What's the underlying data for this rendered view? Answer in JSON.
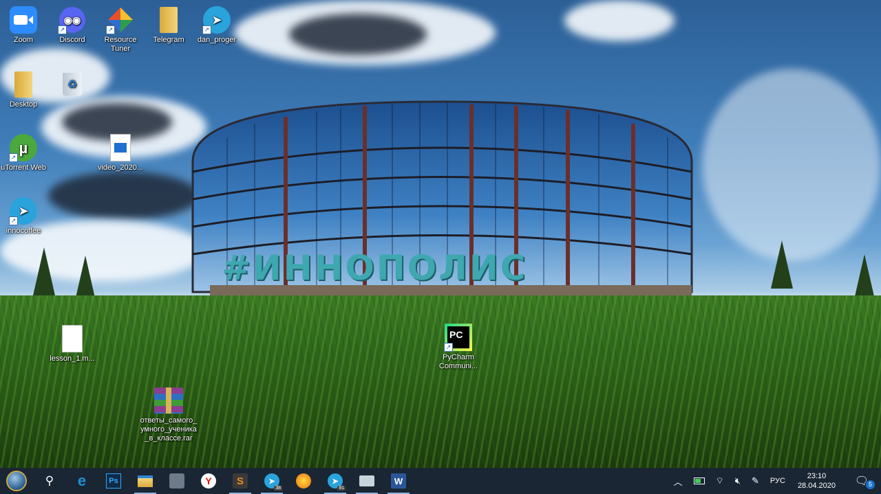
{
  "desktop": {
    "wallpaper_sign": "#ИННОПОЛИС",
    "icons": [
      {
        "label": "Zoom",
        "icon": "zoom-icon",
        "color": "#2d8cff"
      },
      {
        "label": "Discord",
        "icon": "discord-icon",
        "color": "#5865f2"
      },
      {
        "label": "Resource Tuner",
        "icon": "resource-tuner-icon",
        "color": "#e94e2c"
      },
      {
        "label": "Telegram",
        "icon": "folder-icon",
        "color": "#e8c15a"
      },
      {
        "label": "dan_proger",
        "icon": "telegram-icon",
        "color": "#2aa3dc"
      },
      {
        "label": "Desktop",
        "icon": "folder-icon",
        "color": "#e8c15a"
      },
      {
        "label": "",
        "icon": "recycle-bin-icon",
        "color": "#cfd8e3"
      },
      {
        "label": "uTorrent Web",
        "icon": "utorrent-icon",
        "color": "#4aa83c"
      },
      {
        "label": "video_2020...",
        "icon": "video-file-icon",
        "color": "#1d6fd1"
      },
      {
        "label": "innocoffee",
        "icon": "telegram-icon",
        "color": "#2aa3dc"
      },
      {
        "label": "lesson_1.m...",
        "icon": "blank-file-icon",
        "color": "#ffffff"
      },
      {
        "label": "PyCharm Communi...",
        "icon": "pycharm-icon",
        "color": "#21d789"
      },
      {
        "label": "ответы_самого_умного_ученика_в_классе.rar",
        "icon": "winrar-archive-icon",
        "color": "#8b3d8f"
      }
    ]
  },
  "taskbar": {
    "apps": [
      {
        "name": "edge",
        "glyph": "e",
        "color": "#1e90d6"
      },
      {
        "name": "photoshop",
        "glyph": "Ps",
        "color": "#0f2b46"
      },
      {
        "name": "file-explorer",
        "glyph": "",
        "color": "#e8c15a"
      },
      {
        "name": "security",
        "glyph": "",
        "color": "#6c7a89"
      },
      {
        "name": "yandex-browser",
        "glyph": "Y",
        "color": "#ffffff"
      },
      {
        "name": "sublime-text",
        "glyph": "S",
        "color": "#f08b1c"
      },
      {
        "name": "telegram",
        "glyph": "",
        "color": "#2aa3dc",
        "badge": "38"
      },
      {
        "name": "yandex-music",
        "glyph": "",
        "color": "#fdbb2d"
      },
      {
        "name": "telegram-2",
        "glyph": "",
        "color": "#2aa3dc",
        "badge": "91"
      },
      {
        "name": "remote-desktop",
        "glyph": "",
        "color": "#c9d3dc"
      },
      {
        "name": "word",
        "glyph": "W",
        "color": "#2b579a"
      }
    ],
    "tray": {
      "language": "РУС",
      "time": "23:10",
      "date": "28.04.2020",
      "notification_count": "5"
    }
  }
}
